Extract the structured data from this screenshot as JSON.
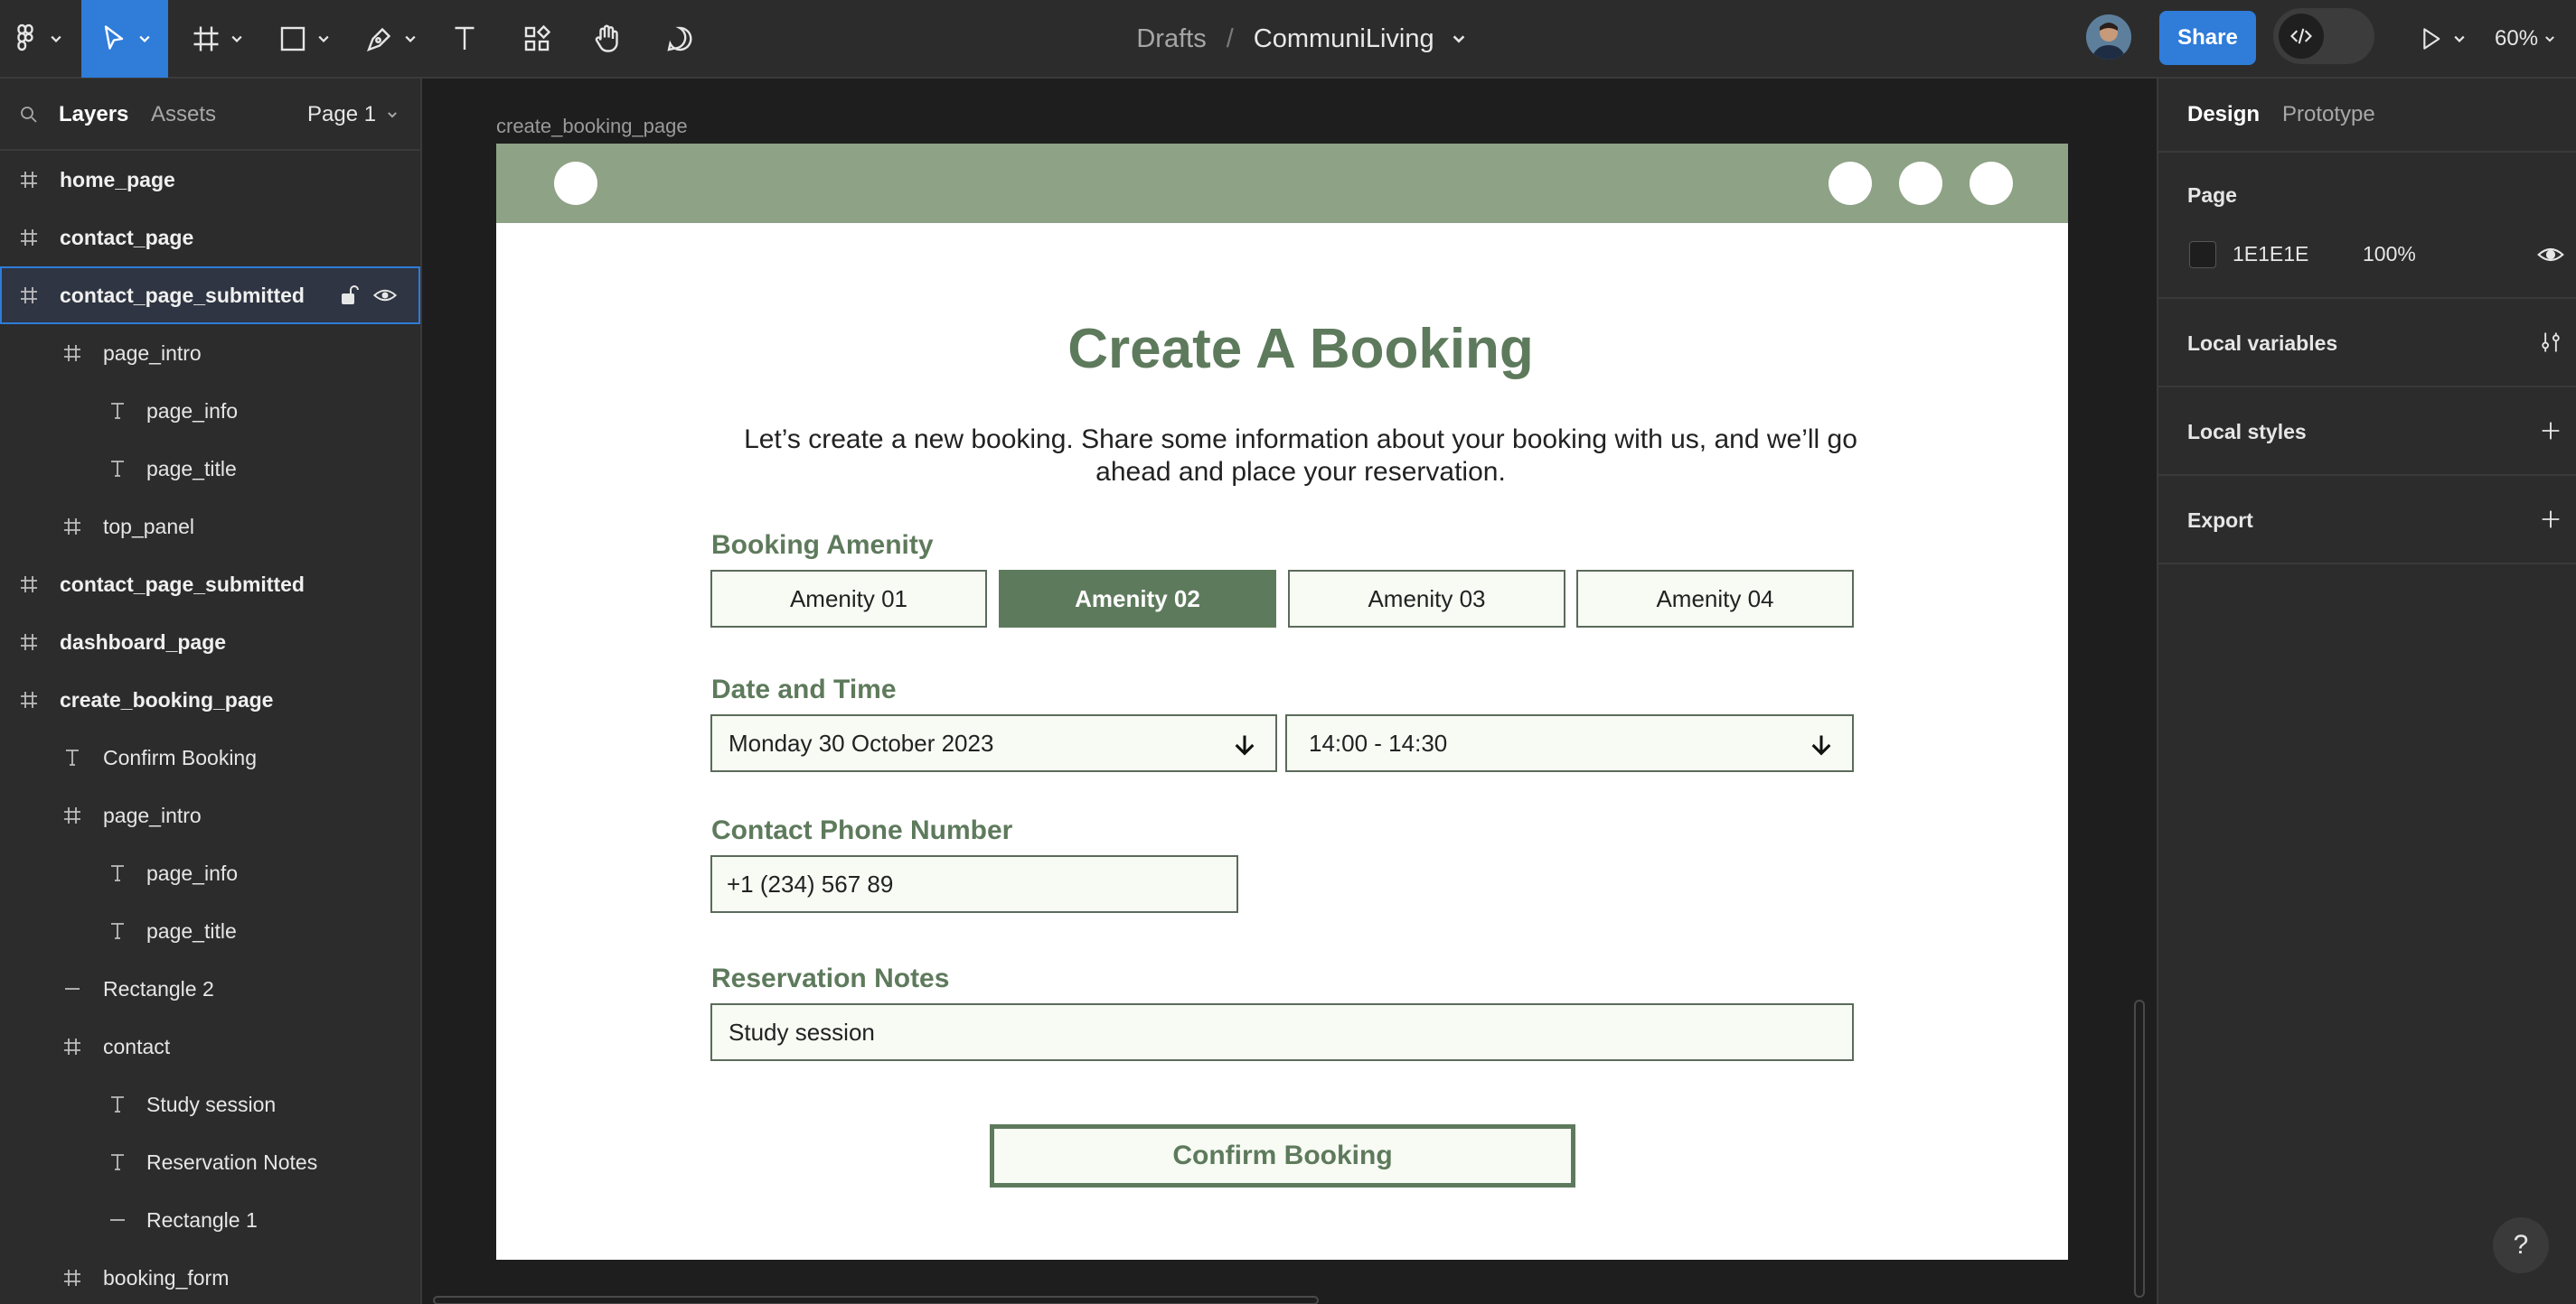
{
  "toolbar": {
    "breadcrumb_parent": "Drafts",
    "breadcrumb_separator": "/",
    "file_name": "CommuniLiving",
    "share_label": "Share",
    "zoom": "60%"
  },
  "left_panel": {
    "tabs": {
      "layers": "Layers",
      "assets": "Assets"
    },
    "page_selector": "Page 1",
    "layers": [
      {
        "name": "home_page",
        "type": "frame",
        "depth": 0
      },
      {
        "name": "contact_page",
        "type": "frame",
        "depth": 0
      },
      {
        "name": "contact_page_submitted",
        "type": "frame",
        "depth": 0,
        "selected": true
      },
      {
        "name": "page_intro",
        "type": "frame",
        "depth": 1
      },
      {
        "name": "page_info",
        "type": "text",
        "depth": 2
      },
      {
        "name": "page_title",
        "type": "text",
        "depth": 2
      },
      {
        "name": "top_panel",
        "type": "frame",
        "depth": 1
      },
      {
        "name": "contact_page_submitted",
        "type": "frame",
        "depth": 0
      },
      {
        "name": "dashboard_page",
        "type": "frame",
        "depth": 0
      },
      {
        "name": "create_booking_page",
        "type": "frame",
        "depth": 0
      },
      {
        "name": "Confirm Booking",
        "type": "text",
        "depth": 1
      },
      {
        "name": "page_intro",
        "type": "frame",
        "depth": 1
      },
      {
        "name": "page_info",
        "type": "text",
        "depth": 2
      },
      {
        "name": "page_title",
        "type": "text",
        "depth": 2
      },
      {
        "name": "Rectangle 2",
        "type": "line",
        "depth": 1
      },
      {
        "name": "contact",
        "type": "frame",
        "depth": 1
      },
      {
        "name": "Study session",
        "type": "text",
        "depth": 2
      },
      {
        "name": "Reservation Notes",
        "type": "text",
        "depth": 2
      },
      {
        "name": "Rectangle 1",
        "type": "line",
        "depth": 2
      },
      {
        "name": "booking_form",
        "type": "frame",
        "depth": 1
      }
    ]
  },
  "canvas": {
    "frame_label": "create_booking_page",
    "page_title": "Create A Booking",
    "page_info": "Let’s create a new booking. Share some information about your booking with us, and we’ll go ahead and place your reservation.",
    "amenity_label": "Booking Amenity",
    "amenities": [
      "Amenity 01",
      "Amenity 02",
      "Amenity 03",
      "Amenity 04"
    ],
    "selected_amenity": "Amenity 02",
    "date_time_label": "Date and Time",
    "date_value": "Monday 30 October 2023",
    "time_value": "14:00 - 14:30",
    "phone_label": "Contact Phone Number",
    "phone_value": "+1 (234) 567 89",
    "notes_label": "Reservation Notes",
    "notes_value": "Study session",
    "confirm_label": "Confirm Booking"
  },
  "right_panel": {
    "tabs": {
      "design": "Design",
      "prototype": "Prototype"
    },
    "page_section": "Page",
    "page_color": "1E1E1E",
    "page_opacity": "100%",
    "local_variables": "Local variables",
    "local_styles": "Local styles",
    "export": "Export"
  },
  "help_label": "?",
  "colors": {
    "accent": "#2f7cd9",
    "brand_green": "#5e7a5c",
    "top_panel_green": "#8ea285",
    "page_background": "#1e1e1e"
  }
}
